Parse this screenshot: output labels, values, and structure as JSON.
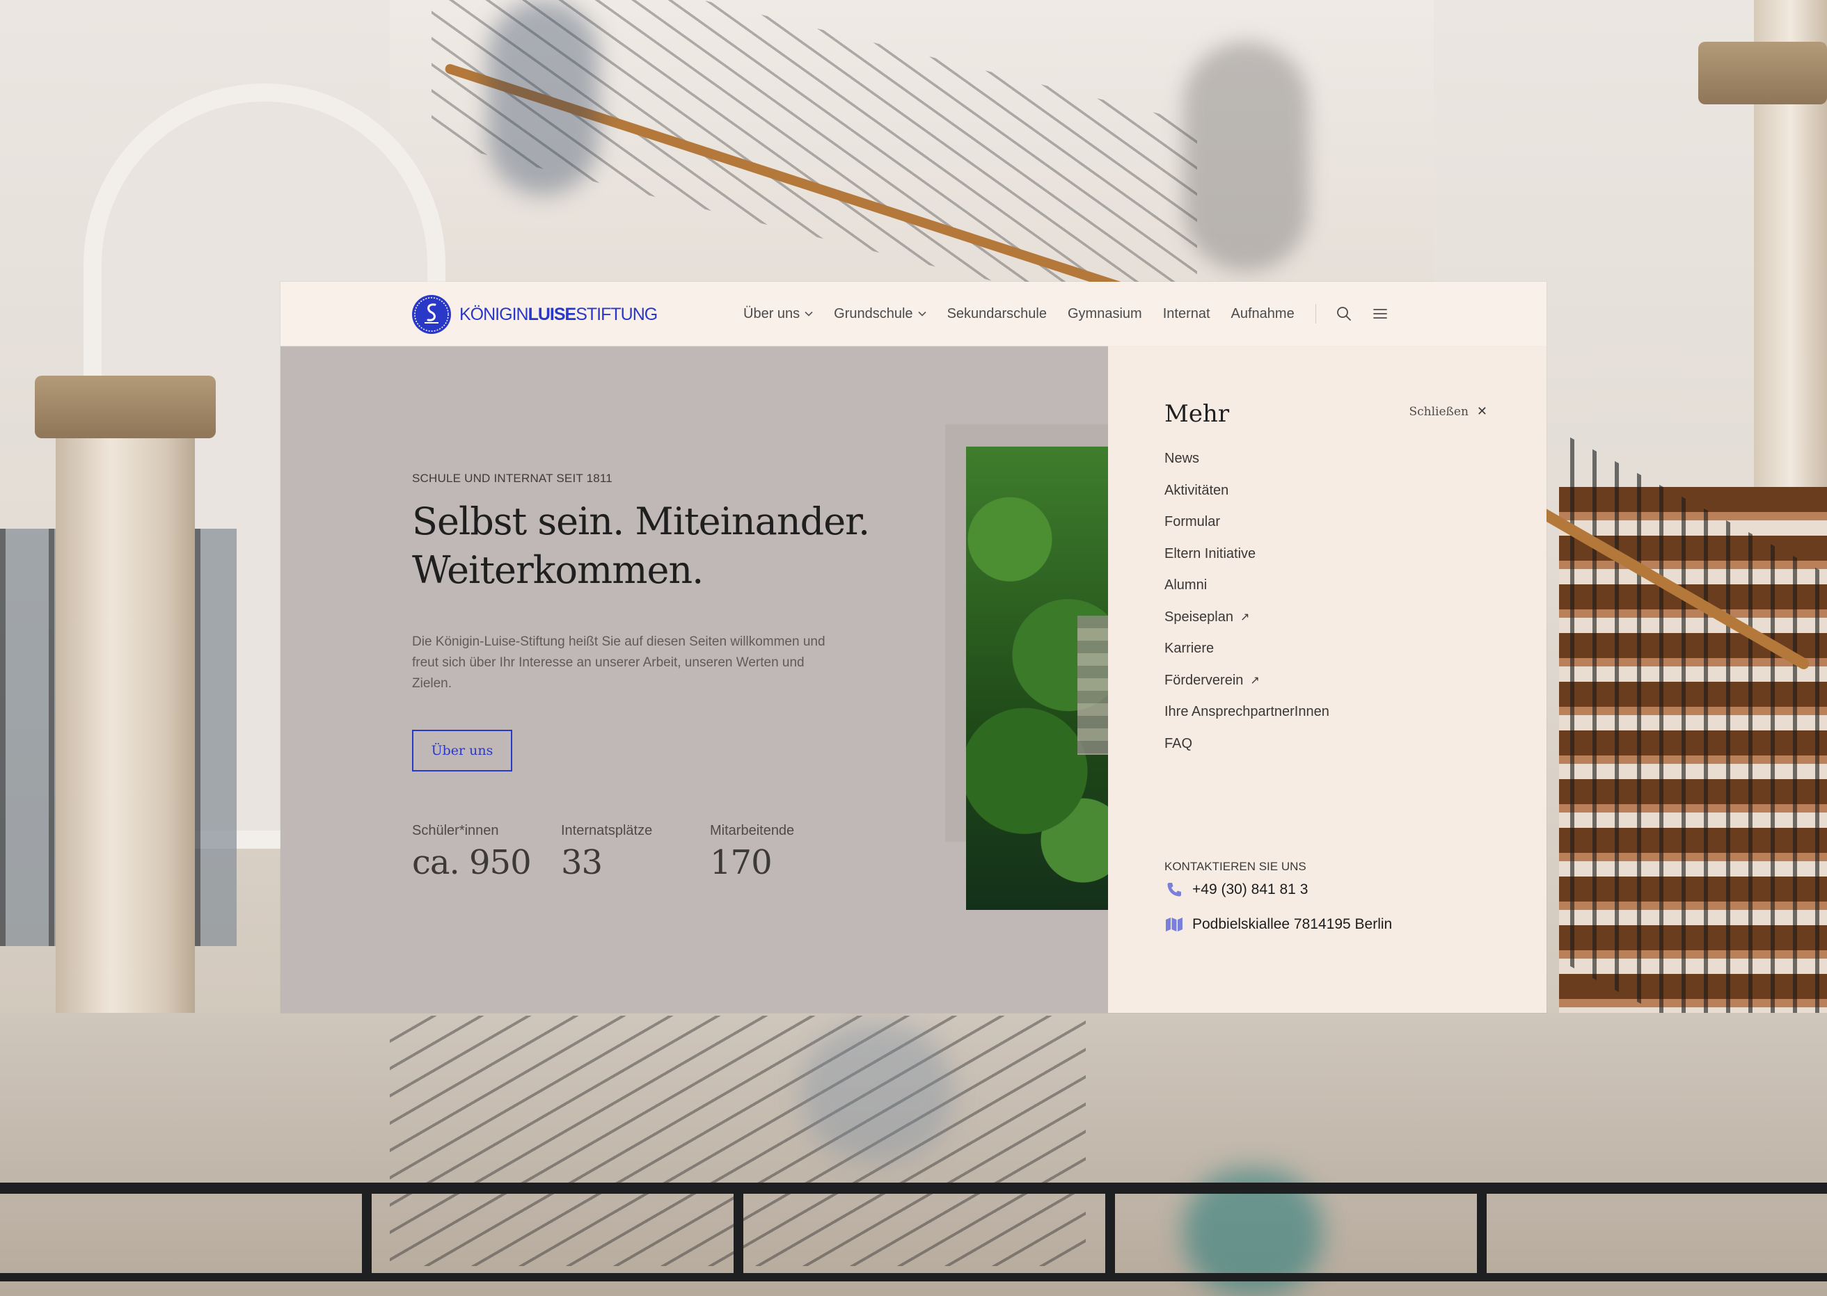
{
  "brand": {
    "name_part1": "KÖNIGIN",
    "name_part2": "LUISE",
    "name_part3": "STIFTUNG",
    "accent_color": "#2a38c7",
    "logo_icon": "seal-icon"
  },
  "nav": {
    "items": [
      {
        "label": "Über uns",
        "has_dropdown": true
      },
      {
        "label": "Grundschule",
        "has_dropdown": true
      },
      {
        "label": "Sekundarschule",
        "has_dropdown": false
      },
      {
        "label": "Gymnasium",
        "has_dropdown": false
      },
      {
        "label": "Internat",
        "has_dropdown": false
      },
      {
        "label": "Aufnahme",
        "has_dropdown": false
      }
    ],
    "search_icon": "search-icon",
    "menu_icon": "hamburger-icon"
  },
  "hero": {
    "eyebrow": "SCHULE UND INTERNAT SEIT 1811",
    "title_line1": "Selbst sein. Miteinander.",
    "title_line2": "Weiterkommen.",
    "text": "Die Königin-Luise-Stiftung heißt Sie auf diesen Seiten willkommen und freut sich über Ihr Interesse an unserer Arbeit, unseren Werten und Zielen.",
    "cta_label": "Über uns"
  },
  "stats": [
    {
      "label": "Schüler*innen",
      "value": "ca. 950"
    },
    {
      "label": "Internatsplätze",
      "value": "33"
    },
    {
      "label": "Mitarbeitende",
      "value": "170"
    }
  ],
  "drawer": {
    "title": "Mehr",
    "close_label": "Schließen",
    "items": [
      {
        "label": "News",
        "external": false
      },
      {
        "label": "Aktivitäten",
        "external": false
      },
      {
        "label": "Formular",
        "external": false
      },
      {
        "label": "Eltern Initiative",
        "external": false
      },
      {
        "label": "Alumni",
        "external": false
      },
      {
        "label": "Speiseplan",
        "external": true
      },
      {
        "label": "Karriere",
        "external": false
      },
      {
        "label": "Förderverein",
        "external": true
      },
      {
        "label": "Ihre AnsprechpartnerInnen",
        "external": false
      },
      {
        "label": "FAQ",
        "external": false
      }
    ],
    "contact_title": "KONTAKTIEREN SIE UNS",
    "phone": "+49 (30) 841 81 3",
    "address": "Podbielskiallee 7814195 Berlin",
    "contact_icon_color": "#7a7fd9"
  }
}
